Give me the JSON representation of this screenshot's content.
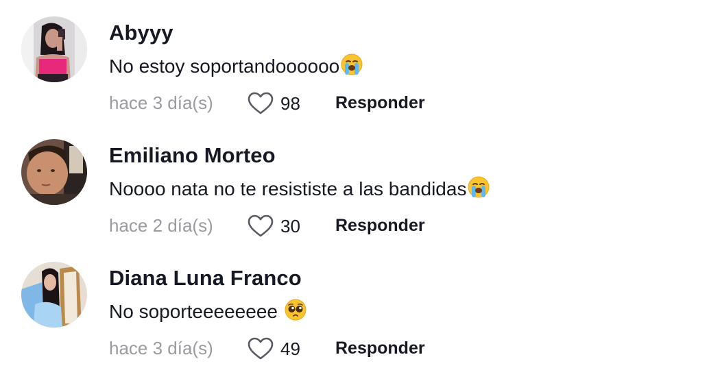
{
  "comments": [
    {
      "username": "Abyyy",
      "text": "No estoy soportandoooooo",
      "emoji": "loudly-crying-face-emoji",
      "time": "hace 3 día(s)",
      "likes": "98",
      "reply_label": "Responder"
    },
    {
      "username": "Emiliano Morteo",
      "text": "Noooo nata no te resististe a las bandidas",
      "emoji": "loudly-crying-face-emoji",
      "time": "hace 2 día(s)",
      "likes": "30",
      "reply_label": "Responder"
    },
    {
      "username": "Diana Luna Franco",
      "text": "No soporteeeeeeee",
      "emoji": "pleading-face-emoji",
      "time": "hace 3 día(s)",
      "likes": "49",
      "reply_label": "Responder"
    }
  ],
  "colors": {
    "text_primary": "#161823",
    "text_secondary": "#9a9ba0",
    "background": "#ffffff"
  }
}
